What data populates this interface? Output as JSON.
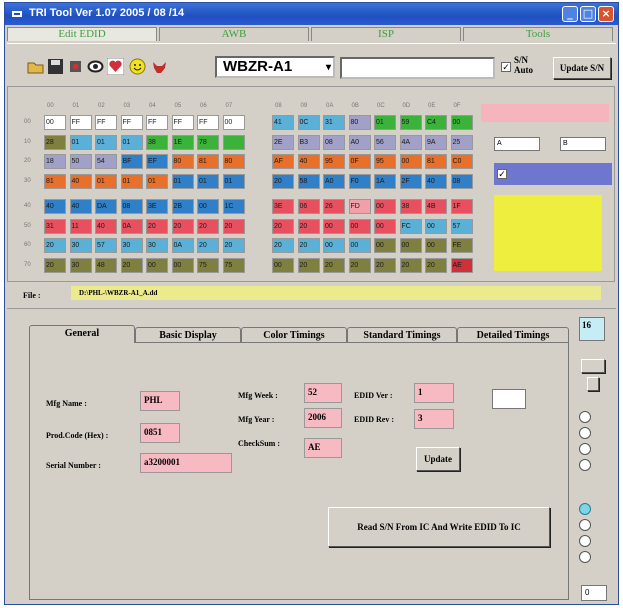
{
  "window": {
    "title": "TRI Tool  Ver 1.07 2005 / 08 /14"
  },
  "menu_tabs": [
    "Edit   EDID",
    "AWB",
    "ISP",
    "Tools"
  ],
  "toolbar": {
    "model": "WBZR-A1",
    "sn_auto_label_1": "S/N",
    "sn_auto_label_2": "Auto",
    "sn_auto_checked": "✓",
    "update_sn": "Update S/N",
    "icons": [
      "open-folder-icon",
      "save-disk-icon",
      "chip-icon",
      "eye-icon",
      "heart-icon",
      "smiley-icon",
      "bull-icon"
    ]
  },
  "grid": {
    "headers": [
      "00",
      "01",
      "02",
      "03",
      "04",
      "05",
      "06",
      "07"
    ],
    "headers_right": [
      "08",
      "09",
      "0A",
      "0B",
      "0C",
      "0D",
      "0E",
      "0F"
    ],
    "row_labels": [
      "00",
      "10",
      "20",
      "30",
      "40",
      "50",
      "60",
      "70"
    ],
    "rows_left": [
      [
        "00",
        "FF",
        "FF",
        "FF",
        "FF",
        "FF",
        "FF",
        "00"
      ],
      [
        "28",
        "01",
        "01",
        "01",
        "38",
        "1E",
        "78",
        ""
      ],
      [
        "18",
        "50",
        "54",
        "BF",
        "EF",
        "80",
        "81",
        "80"
      ],
      [
        "81",
        "40",
        "01",
        "01",
        "01",
        "01",
        "01",
        "01"
      ],
      [
        "40",
        "40",
        "DA",
        "08",
        "3E",
        "2B",
        "00",
        "1C"
      ],
      [
        "31",
        "11",
        "40",
        "0A",
        "20",
        "20",
        "20",
        "20"
      ],
      [
        "20",
        "30",
        "57",
        "30",
        "30",
        "0A",
        "20",
        "20"
      ],
      [
        "20",
        "30",
        "48",
        "20",
        "00",
        "00",
        "75",
        "75"
      ]
    ],
    "rows_right": [
      [
        "41",
        "0C",
        "31",
        "80",
        "01",
        "59",
        "C4",
        "00"
      ],
      [
        "2E",
        "B3",
        "08",
        "A0",
        "56",
        "4A",
        "9A",
        "25"
      ],
      [
        "AF",
        "40",
        "95",
        "0F",
        "95",
        "00",
        "81",
        "C0"
      ],
      [
        "20",
        "58",
        "A0",
        "F0",
        "1A",
        "2F",
        "40",
        "08"
      ],
      [
        "3E",
        "06",
        "26",
        "FD",
        "00",
        "38",
        "4B",
        "1F"
      ],
      [
        "20",
        "20",
        "00",
        "00",
        "00",
        "FC",
        "00",
        "57"
      ],
      [
        "20",
        "20",
        "00",
        "00",
        "00",
        "00",
        "00",
        "FE"
      ],
      [
        "00",
        "20",
        "20",
        "20",
        "20",
        "20",
        "20",
        "AE"
      ]
    ],
    "colors_left": [
      [
        "#ffffff",
        "#ffffff",
        "#ffffff",
        "#ffffff",
        "#ffffff",
        "#ffffff",
        "#ffffff",
        "#ffffff"
      ],
      [
        "#7f7f3f",
        "#5bb0d8",
        "#5bb0d8",
        "#5bb0d8",
        "#3bb33b",
        "#3bb33b",
        "#3bb33b",
        "#3bb33b"
      ],
      [
        "#a0a0c8",
        "#a0a0c8",
        "#a0a0c8",
        "#2f80c8",
        "#2f80c8",
        "#e8702a",
        "#e8702a",
        "#e8702a"
      ],
      [
        "#e8702a",
        "#e8702a",
        "#e8702a",
        "#e8702a",
        "#e8702a",
        "#2f80c8",
        "#2f80c8",
        "#2f80c8"
      ],
      [
        "#2f80c8",
        "#2f80c8",
        "#2f80c8",
        "#2f80c8",
        "#2f80c8",
        "#2f80c8",
        "#2f80c8",
        "#2f80c8"
      ],
      [
        "#e85060",
        "#e85060",
        "#e85060",
        "#e85060",
        "#e85060",
        "#e85060",
        "#e85060",
        "#e85060"
      ],
      [
        "#5bb0d8",
        "#5bb0d8",
        "#5bb0d8",
        "#5bb0d8",
        "#5bb0d8",
        "#5bb0d8",
        "#5bb0d8",
        "#5bb0d8"
      ],
      [
        "#7f7f3f",
        "#7f7f3f",
        "#7f7f3f",
        "#7f7f3f",
        "#7f7f3f",
        "#7f7f3f",
        "#7f7f3f",
        "#7f7f3f"
      ]
    ],
    "colors_right": [
      [
        "#5bb0d8",
        "#5bb0d8",
        "#5bb0d8",
        "#a0a0c8",
        "#3bb33b",
        "#3bb33b",
        "#3bb33b",
        "#3bb33b"
      ],
      [
        "#a0a0c8",
        "#a0a0c8",
        "#a0a0c8",
        "#a0a0c8",
        "#a0a0c8",
        "#a0a0c8",
        "#a0a0c8",
        "#a0a0c8"
      ],
      [
        "#e8702a",
        "#e8702a",
        "#e8702a",
        "#e8702a",
        "#e8702a",
        "#e8702a",
        "#e8702a",
        "#e8702a"
      ],
      [
        "#2f80c8",
        "#2f80c8",
        "#2f80c8",
        "#2f80c8",
        "#2f80c8",
        "#2f80c8",
        "#2f80c8",
        "#2f80c8"
      ],
      [
        "#e85060",
        "#e85060",
        "#e85060",
        "#f1a0aa",
        "#e85060",
        "#e85060",
        "#e85060",
        "#e85060"
      ],
      [
        "#e85060",
        "#e85060",
        "#e85060",
        "#e85060",
        "#e85060",
        "#5bb0d8",
        "#5bb0d8",
        "#5bb0d8"
      ],
      [
        "#5bb0d8",
        "#5bb0d8",
        "#5bb0d8",
        "#5bb0d8",
        "#7f7f3f",
        "#7f7f3f",
        "#7f7f3f",
        "#7f7f3f"
      ],
      [
        "#7f7f3f",
        "#7f7f3f",
        "#7f7f3f",
        "#7f7f3f",
        "#7f7f3f",
        "#7f7f3f",
        "#7f7f3f",
        "#d0303a"
      ]
    ],
    "side_input_1": "A",
    "side_input_2": "B",
    "checkbox_mark": "✓"
  },
  "file": {
    "label": "File :",
    "path": "D:\\PHL-\\WBZR-A1_A.dd"
  },
  "tabs": [
    "General",
    "Basic Display",
    "Color Timings",
    "Standard Timings",
    "Detailed Timings"
  ],
  "form": {
    "mfg_name_label": "Mfg Name :",
    "mfg_name": "PHL",
    "prod_code_label": "Prod.Code (Hex) :",
    "prod_code": "0851",
    "serial_label": "Serial Number :",
    "serial": "a3200001",
    "mfg_week_label": "Mfg Week :",
    "mfg_week": "52",
    "mfg_year_label": "Mfg Year :",
    "mfg_year": "2006",
    "checksum_label": "CheckSum :",
    "checksum": "AE",
    "edid_ver_label": "EDID Ver :",
    "edid_ver": "1",
    "edid_rev_label": "EDID Rev :",
    "edid_rev": "3",
    "update_button": "Update",
    "write_button": "Read S/N From IC And Write EDID To IC"
  },
  "side": {
    "top_value": "16",
    "bottom_value": "0"
  }
}
